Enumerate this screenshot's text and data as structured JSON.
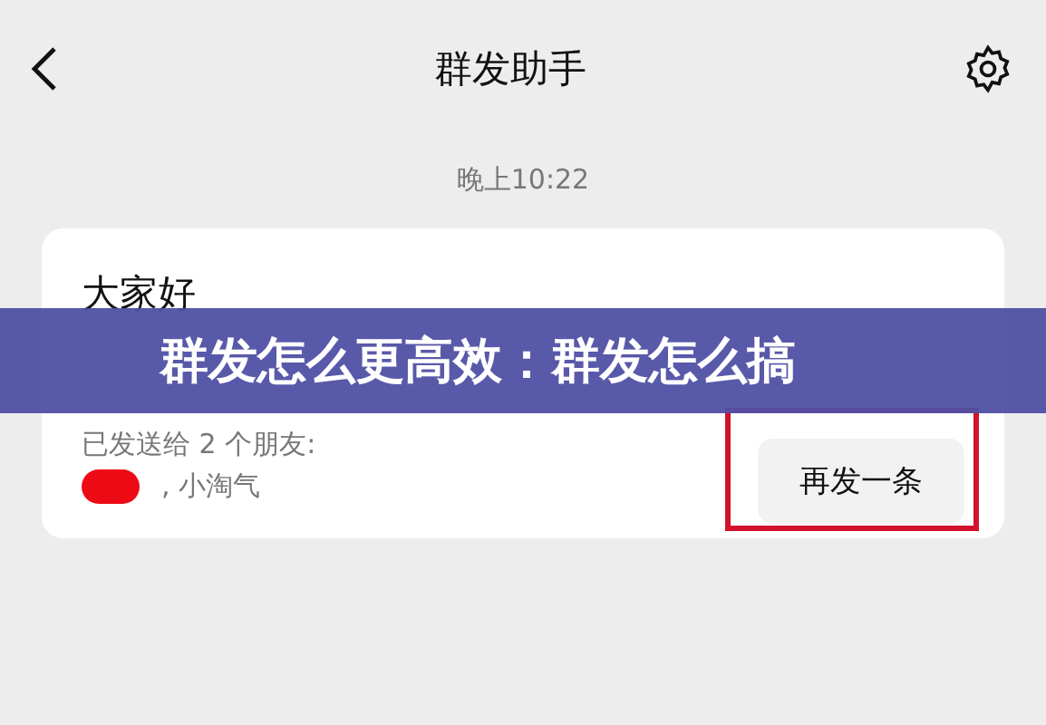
{
  "header": {
    "title": "群发助手"
  },
  "timestamp": "晚上10:22",
  "message": {
    "text": "大家好",
    "sent_to": "已发送给 2 个朋友:",
    "recipients": ", 小淘气",
    "resend_button": "再发一条"
  },
  "banner": {
    "title": "群发怎么更高效：群发怎么搞"
  }
}
